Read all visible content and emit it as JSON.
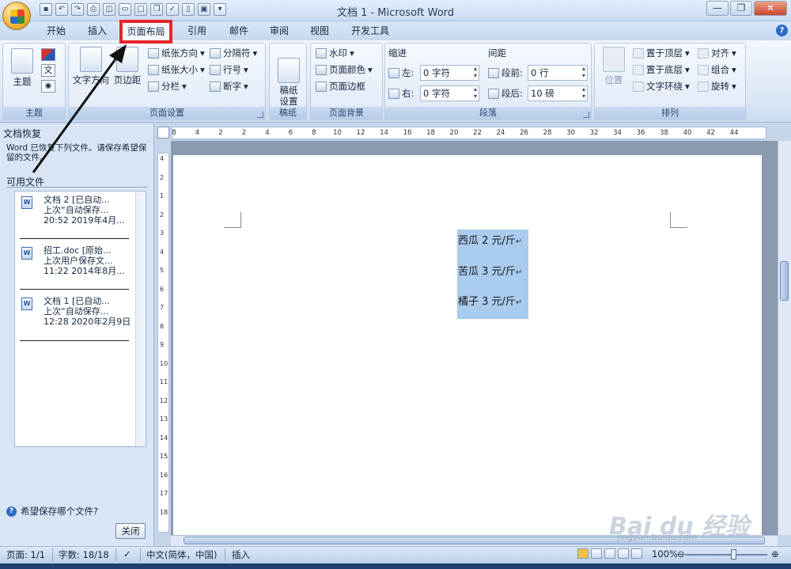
{
  "window": {
    "title": "文档 1 - Microsoft Word"
  },
  "tabs": [
    "开始",
    "插入",
    "页面布局",
    "引用",
    "邮件",
    "审阅",
    "视图",
    "开发工具"
  ],
  "groups": {
    "theme": {
      "label": "主题",
      "btn": "主题"
    },
    "page_setup": {
      "label": "页面设置",
      "text_dir": "文字方向",
      "margins": "页边距",
      "orientation": "纸张方向",
      "size": "纸张大小",
      "columns": "分栏",
      "breaks": "分隔符",
      "line_numbers": "行号",
      "hyphen": "断字"
    },
    "draft": {
      "label": "稿纸",
      "btn": "稿纸\n设置"
    },
    "page_bg": {
      "label": "页面背景",
      "watermark": "水印",
      "page_color": "页面颜色",
      "page_border": "页面边框"
    },
    "paragraph": {
      "label": "段落",
      "indent": "缩进",
      "spacing": "间距",
      "left": "左:",
      "right": "右:",
      "left_val": "0 字符",
      "right_val": "0 字符",
      "before": "段前:",
      "after": "段后:",
      "before_val": "0 行",
      "after_val": "10 磅"
    },
    "arrange": {
      "label": "排列",
      "position": "位置",
      "front": "置于顶层",
      "back": "置于底层",
      "wrap": "文字环绕",
      "align": "对齐",
      "group": "组合",
      "rotate": "旋转"
    }
  },
  "pane": {
    "title": "文档恢复",
    "message": "Word 已恢复下列文件。请保存希望保留的文件。",
    "available": "可用文件",
    "files": [
      {
        "l1": "文档 2 [已自动...",
        "l2": "上次“自动保存...",
        "l3": "20:52 2019年4月..."
      },
      {
        "l1": "招工.doc [原始...",
        "l2": "上次用户保存文...",
        "l3": "11:22 2014年8月..."
      },
      {
        "l1": "文档 1 [已自动...",
        "l2": "上次“自动保存...",
        "l3": "12:28 2020年2月9日"
      }
    ],
    "help": "希望保存哪个文件?",
    "close": "关闭"
  },
  "ruler": {
    "h_ticks": [
      "8",
      "4",
      "2",
      "2",
      "4",
      "6",
      "8",
      "10",
      "12",
      "14",
      "16",
      "18",
      "20",
      "22",
      "24",
      "26",
      "28",
      "30",
      "32",
      "34",
      "36",
      "38",
      "40",
      "42",
      "44"
    ],
    "v_ticks": [
      "4",
      "2",
      "1",
      "2",
      "3",
      "4",
      "5",
      "6",
      "7",
      "8",
      "9",
      "10",
      "11",
      "12",
      "13",
      "14",
      "15",
      "16",
      "17",
      "18"
    ]
  },
  "document": {
    "lines": [
      "西瓜 2 元/斤",
      "苦瓜 3 元/斤",
      "橘子 3 元/斤"
    ],
    "para_mark": "↵"
  },
  "status": {
    "page": "页面: 1/1",
    "words": "字数: 18/18",
    "lang": "中文(简体，中国)",
    "mode": "插入",
    "zoom": "100%"
  },
  "watermark": {
    "brand": "Bai du 经验",
    "url": "jingyan.baidu.com"
  }
}
